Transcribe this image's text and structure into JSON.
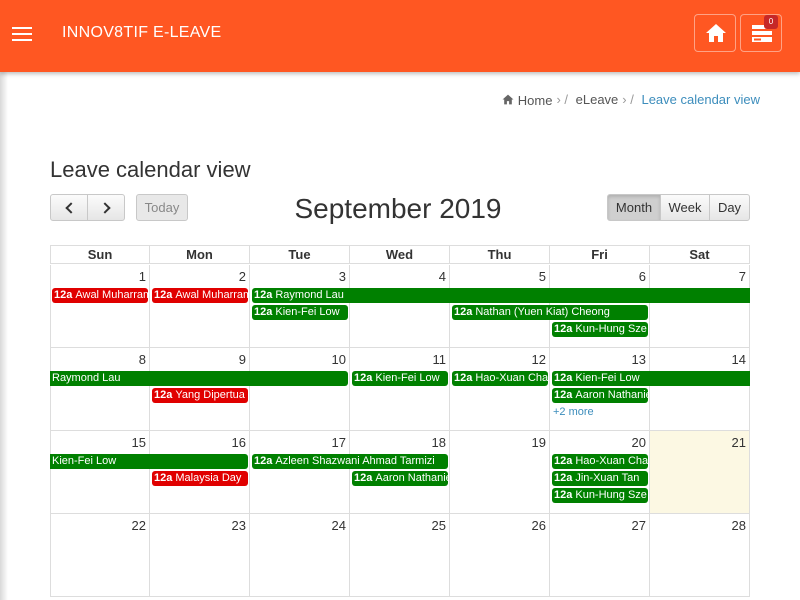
{
  "app": {
    "brand": "INNOV8TIF E-LEAVE",
    "notification_count": "0"
  },
  "breadcrumb": {
    "home": "Home",
    "eleave": "eLeave",
    "current": "Leave calendar view"
  },
  "page": {
    "title": "Leave calendar view"
  },
  "toolbar": {
    "today": "Today",
    "month": "Month",
    "week": "Week",
    "day": "Day"
  },
  "calendar": {
    "title": "September 2019",
    "days_of_week": [
      "Sun",
      "Mon",
      "Tue",
      "Wed",
      "Thu",
      "Fri",
      "Sat"
    ],
    "weeks": [
      {
        "days": [
          "1",
          "2",
          "3",
          "4",
          "5",
          "6",
          "7"
        ]
      },
      {
        "days": [
          "8",
          "9",
          "10",
          "11",
          "12",
          "13",
          "14"
        ]
      },
      {
        "days": [
          "15",
          "16",
          "17",
          "18",
          "19",
          "20",
          "21"
        ]
      },
      {
        "days": [
          "22",
          "23",
          "24",
          "25",
          "26",
          "27",
          "28"
        ]
      }
    ],
    "today_day": "21",
    "more_label": "+2 more",
    "events": [
      {
        "week": 0,
        "start": 0,
        "span": 1,
        "row": 0,
        "time": "12a",
        "title": "Awal Muharram",
        "color": "red"
      },
      {
        "week": 0,
        "start": 1,
        "span": 1,
        "row": 0,
        "time": "12a",
        "title": "Awal Muharram",
        "color": "red"
      },
      {
        "week": 0,
        "start": 2,
        "span": 5,
        "row": 0,
        "time": "12a",
        "title": "Raymond Lau",
        "color": "green",
        "continues": "right"
      },
      {
        "week": 0,
        "start": 2,
        "span": 1,
        "row": 1,
        "time": "12a",
        "title": "Kien-Fei Low",
        "color": "green"
      },
      {
        "week": 0,
        "start": 4,
        "span": 2,
        "row": 1,
        "time": "12a",
        "title": "Nathan (Yuen Kiat) Cheong",
        "color": "green"
      },
      {
        "week": 0,
        "start": 5,
        "span": 1,
        "row": 2,
        "time": "12a",
        "title": "Kun-Hung Sze",
        "color": "green"
      },
      {
        "week": 1,
        "start": 0,
        "span": 3,
        "row": 0,
        "time": "",
        "title": "Raymond Lau",
        "color": "green",
        "continues": "left"
      },
      {
        "week": 1,
        "start": 3,
        "span": 1,
        "row": 0,
        "time": "12a",
        "title": "Kien-Fei Low",
        "color": "green"
      },
      {
        "week": 1,
        "start": 4,
        "span": 1,
        "row": 0,
        "time": "12a",
        "title": "Hao-Xuan Chang",
        "color": "green"
      },
      {
        "week": 1,
        "start": 5,
        "span": 2,
        "row": 0,
        "time": "12a",
        "title": "Kien-Fei Low",
        "color": "green",
        "continues": "right"
      },
      {
        "week": 1,
        "start": 1,
        "span": 1,
        "row": 1,
        "time": "12a",
        "title": "Yang Dipertua",
        "color": "red"
      },
      {
        "week": 1,
        "start": 5,
        "span": 1,
        "row": 1,
        "time": "12a",
        "title": "Aaron Nathaniel",
        "color": "green"
      },
      {
        "week": 2,
        "start": 0,
        "span": 2,
        "row": 0,
        "time": "",
        "title": "Kien-Fei Low",
        "color": "green",
        "continues": "left"
      },
      {
        "week": 2,
        "start": 2,
        "span": 2,
        "row": 0,
        "time": "12a",
        "title": "Azleen Shazwani Ahmad Tarmizi",
        "color": "green"
      },
      {
        "week": 2,
        "start": 5,
        "span": 1,
        "row": 0,
        "time": "12a",
        "title": "Hao-Xuan Chang",
        "color": "green"
      },
      {
        "week": 2,
        "start": 1,
        "span": 1,
        "row": 1,
        "time": "12a",
        "title": "Malaysia Day",
        "color": "red"
      },
      {
        "week": 2,
        "start": 3,
        "span": 1,
        "row": 1,
        "time": "12a",
        "title": "Aaron Nathaniel",
        "color": "green"
      },
      {
        "week": 2,
        "start": 5,
        "span": 1,
        "row": 1,
        "time": "12a",
        "title": "Jin-Xuan Tan",
        "color": "green"
      },
      {
        "week": 2,
        "start": 5,
        "span": 1,
        "row": 2,
        "time": "12a",
        "title": "Kun-Hung Sze",
        "color": "green"
      }
    ],
    "more_links": [
      {
        "week": 1,
        "day": 5,
        "row": 2
      }
    ]
  },
  "colors": {
    "topbar": "#ff5722",
    "event_green": "#008000",
    "event_red": "#e00000",
    "link": "#3c8dbc",
    "today_bg": "#fcf8e3"
  }
}
